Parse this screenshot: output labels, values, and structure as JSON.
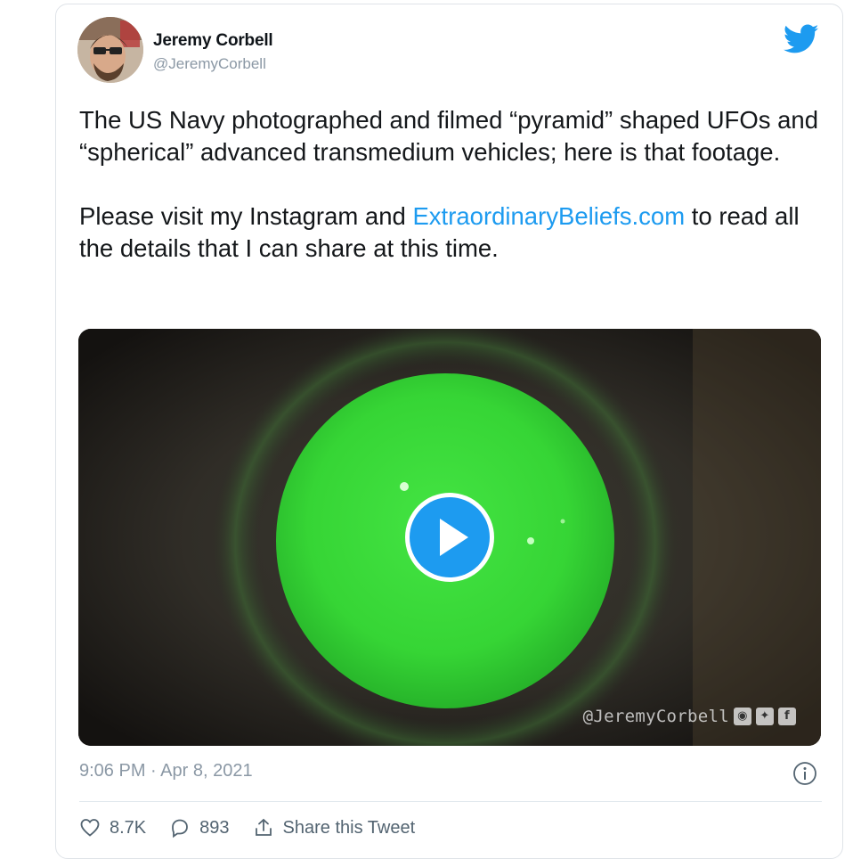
{
  "author": {
    "name": "Jeremy Corbell",
    "handle": "@JeremyCorbell"
  },
  "tweet": {
    "paragraph1": "The US Navy photographed and filmed “pyramid” shaped UFOs and “spherical” advanced transmedium vehicles; here is that footage.",
    "paragraph2_before": "Please visit my Instagram and ",
    "link_text": "ExtraordinaryBeliefs.com",
    "paragraph2_after": " to read all the details that I can share at this time."
  },
  "media": {
    "watermark": "@JeremyCorbell",
    "watermark_icons": [
      "instagram-icon",
      "twitter-icon",
      "facebook-icon"
    ],
    "play_icon": "play-icon"
  },
  "timestamp": "9:06 PM · Apr 8, 2021",
  "actions": {
    "likes": "8.7K",
    "replies": "893",
    "share_label": "Share this Tweet"
  },
  "colors": {
    "brand_blue": "#1d9bf0",
    "text": "#14171a",
    "muted": "#8b98a5",
    "night_vision_green": "#3ddc3a"
  }
}
